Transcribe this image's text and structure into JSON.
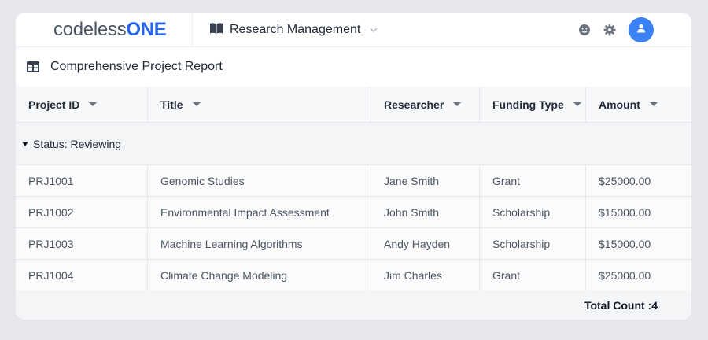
{
  "header": {
    "logo_part1": "codeless",
    "logo_part2": "ONE",
    "app_name": "Research Management"
  },
  "report": {
    "title": "Comprehensive Project Report"
  },
  "table": {
    "columns": [
      "Project ID",
      "Title",
      "Researcher",
      "Funding Type",
      "Amount"
    ],
    "group_label": "Status: Reviewing",
    "rows": [
      [
        "PRJ1001",
        "Genomic Studies",
        "Jane Smith",
        "Grant",
        "$25000.00"
      ],
      [
        "PRJ1002",
        "Environmental Impact Assessment",
        "John Smith",
        "Scholarship",
        "$15000.00"
      ],
      [
        "PRJ1003",
        "Machine Learning Algorithms",
        "Andy Hayden",
        "Scholarship",
        "$15000.00"
      ],
      [
        "PRJ1004",
        "Climate Change Modeling",
        "Jim Charles",
        "Grant",
        "$25000.00"
      ]
    ],
    "footer_total": "Total  Count :4"
  },
  "colors": {
    "accent": "#3b82f6",
    "logo_brand": "#2563eb"
  },
  "icons": [
    "book-icon",
    "emoji-icon",
    "gear-icon",
    "user-icon",
    "table-icon"
  ]
}
